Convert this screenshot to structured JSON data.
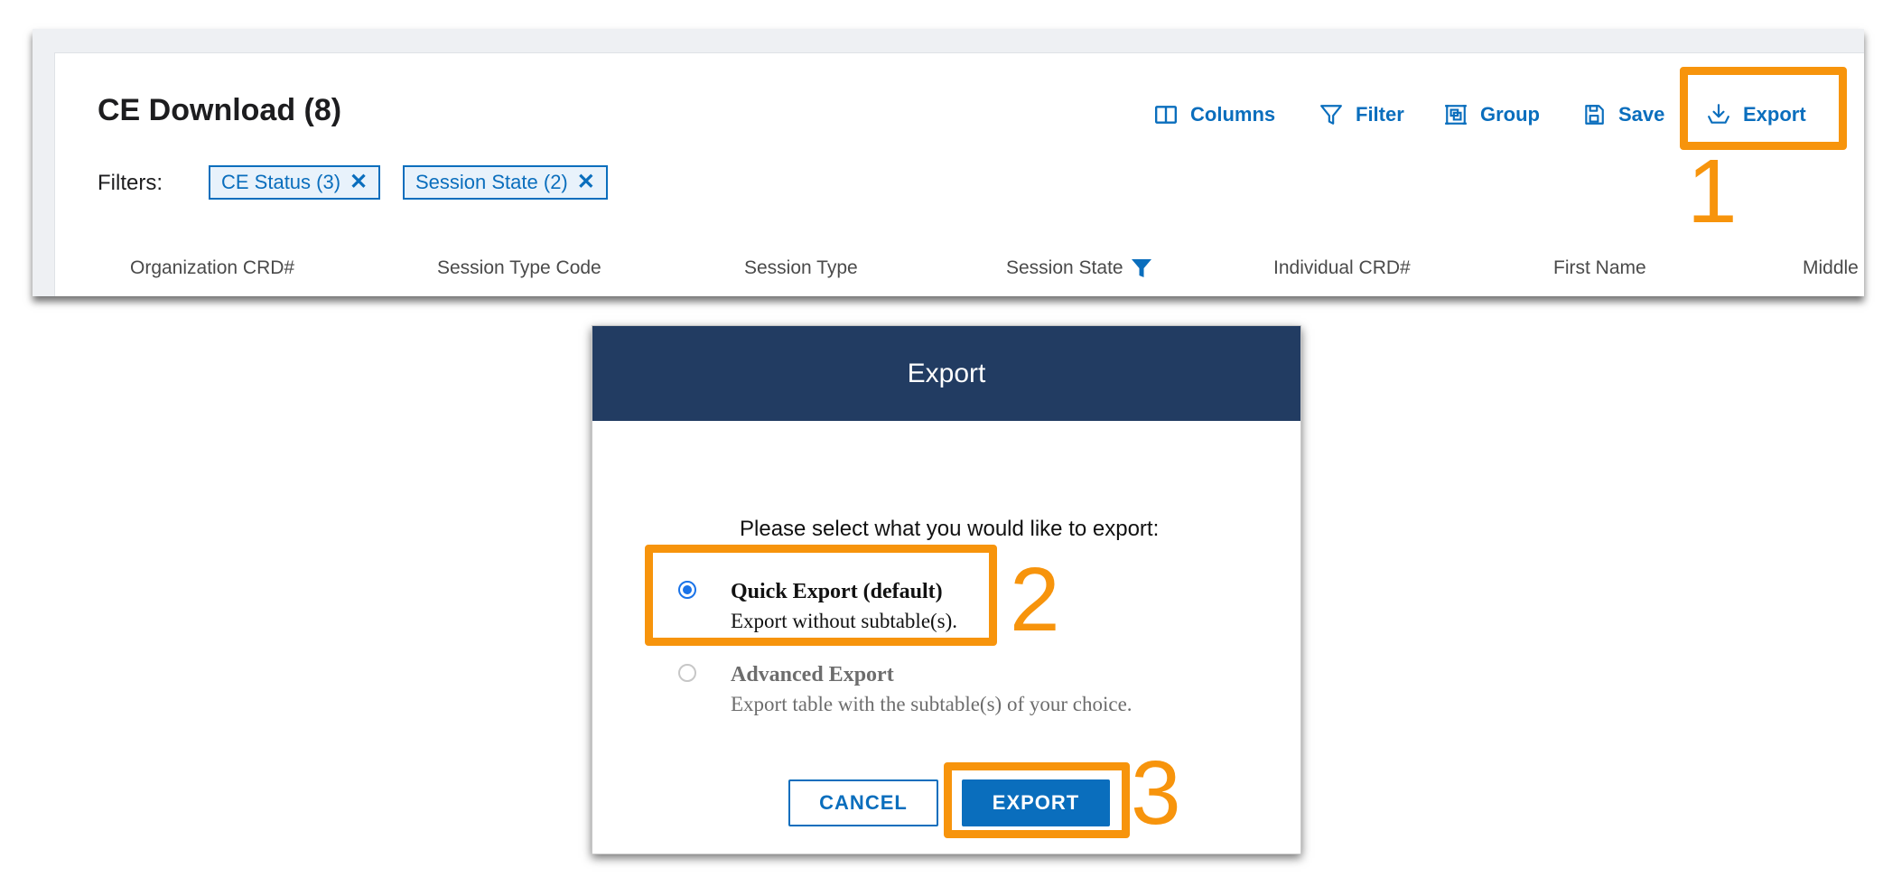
{
  "grid": {
    "title": "CE Download (8)",
    "toolbar": {
      "columns_label": "Columns",
      "filter_label": "Filter",
      "group_label": "Group",
      "save_label": "Save",
      "export_label": "Export"
    },
    "filters_label": "Filters:",
    "chips": [
      {
        "label": "CE Status (3)"
      },
      {
        "label": "Session State (2)"
      }
    ],
    "chip_remove_glyph": "✕",
    "columns": [
      "Organization CRD#",
      "Session Type Code",
      "Session Type",
      "Session State",
      "Individual CRD#",
      "First Name",
      "Middle"
    ]
  },
  "dialog": {
    "title": "Export",
    "prompt": "Please select what you would like to export:",
    "options": [
      {
        "title": "Quick Export (default)",
        "description": "Export without subtable(s).",
        "selected": true
      },
      {
        "title": "Advanced Export",
        "description": "Export table with the subtable(s) of your choice.",
        "selected": false
      }
    ],
    "cancel_label": "CANCEL",
    "export_label": "EXPORT"
  },
  "annotations": {
    "step_1": "1",
    "step_2": "2",
    "step_3": "3"
  },
  "colors": {
    "accent": "#0a6ebd",
    "dialog_header": "#223c62",
    "annotation": "#f7940c",
    "radio_selected": "#1a73e8"
  },
  "icons": {
    "columns": "columns-icon",
    "filter": "filter-icon",
    "group": "group-icon",
    "save": "save-icon",
    "export": "download-icon",
    "column_filter": "funnel-icon"
  }
}
